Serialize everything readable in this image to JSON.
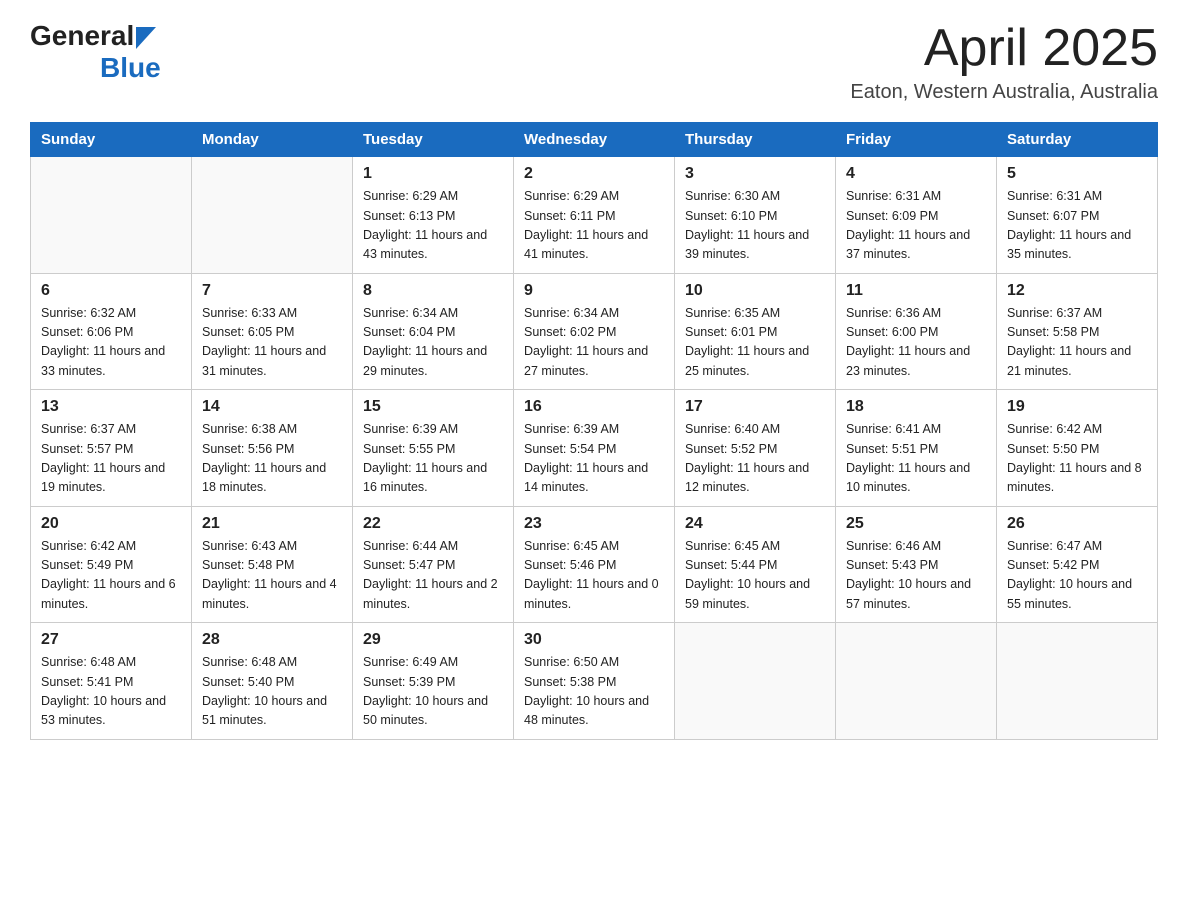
{
  "header": {
    "logo_general": "General",
    "logo_blue": "Blue",
    "title": "April 2025",
    "subtitle": "Eaton, Western Australia, Australia"
  },
  "days_of_week": [
    "Sunday",
    "Monday",
    "Tuesday",
    "Wednesday",
    "Thursday",
    "Friday",
    "Saturday"
  ],
  "weeks": [
    [
      {
        "day": "",
        "sunrise": "",
        "sunset": "",
        "daylight": ""
      },
      {
        "day": "",
        "sunrise": "",
        "sunset": "",
        "daylight": ""
      },
      {
        "day": "1",
        "sunrise": "Sunrise: 6:29 AM",
        "sunset": "Sunset: 6:13 PM",
        "daylight": "Daylight: 11 hours and 43 minutes."
      },
      {
        "day": "2",
        "sunrise": "Sunrise: 6:29 AM",
        "sunset": "Sunset: 6:11 PM",
        "daylight": "Daylight: 11 hours and 41 minutes."
      },
      {
        "day": "3",
        "sunrise": "Sunrise: 6:30 AM",
        "sunset": "Sunset: 6:10 PM",
        "daylight": "Daylight: 11 hours and 39 minutes."
      },
      {
        "day": "4",
        "sunrise": "Sunrise: 6:31 AM",
        "sunset": "Sunset: 6:09 PM",
        "daylight": "Daylight: 11 hours and 37 minutes."
      },
      {
        "day": "5",
        "sunrise": "Sunrise: 6:31 AM",
        "sunset": "Sunset: 6:07 PM",
        "daylight": "Daylight: 11 hours and 35 minutes."
      }
    ],
    [
      {
        "day": "6",
        "sunrise": "Sunrise: 6:32 AM",
        "sunset": "Sunset: 6:06 PM",
        "daylight": "Daylight: 11 hours and 33 minutes."
      },
      {
        "day": "7",
        "sunrise": "Sunrise: 6:33 AM",
        "sunset": "Sunset: 6:05 PM",
        "daylight": "Daylight: 11 hours and 31 minutes."
      },
      {
        "day": "8",
        "sunrise": "Sunrise: 6:34 AM",
        "sunset": "Sunset: 6:04 PM",
        "daylight": "Daylight: 11 hours and 29 minutes."
      },
      {
        "day": "9",
        "sunrise": "Sunrise: 6:34 AM",
        "sunset": "Sunset: 6:02 PM",
        "daylight": "Daylight: 11 hours and 27 minutes."
      },
      {
        "day": "10",
        "sunrise": "Sunrise: 6:35 AM",
        "sunset": "Sunset: 6:01 PM",
        "daylight": "Daylight: 11 hours and 25 minutes."
      },
      {
        "day": "11",
        "sunrise": "Sunrise: 6:36 AM",
        "sunset": "Sunset: 6:00 PM",
        "daylight": "Daylight: 11 hours and 23 minutes."
      },
      {
        "day": "12",
        "sunrise": "Sunrise: 6:37 AM",
        "sunset": "Sunset: 5:58 PM",
        "daylight": "Daylight: 11 hours and 21 minutes."
      }
    ],
    [
      {
        "day": "13",
        "sunrise": "Sunrise: 6:37 AM",
        "sunset": "Sunset: 5:57 PM",
        "daylight": "Daylight: 11 hours and 19 minutes."
      },
      {
        "day": "14",
        "sunrise": "Sunrise: 6:38 AM",
        "sunset": "Sunset: 5:56 PM",
        "daylight": "Daylight: 11 hours and 18 minutes."
      },
      {
        "day": "15",
        "sunrise": "Sunrise: 6:39 AM",
        "sunset": "Sunset: 5:55 PM",
        "daylight": "Daylight: 11 hours and 16 minutes."
      },
      {
        "day": "16",
        "sunrise": "Sunrise: 6:39 AM",
        "sunset": "Sunset: 5:54 PM",
        "daylight": "Daylight: 11 hours and 14 minutes."
      },
      {
        "day": "17",
        "sunrise": "Sunrise: 6:40 AM",
        "sunset": "Sunset: 5:52 PM",
        "daylight": "Daylight: 11 hours and 12 minutes."
      },
      {
        "day": "18",
        "sunrise": "Sunrise: 6:41 AM",
        "sunset": "Sunset: 5:51 PM",
        "daylight": "Daylight: 11 hours and 10 minutes."
      },
      {
        "day": "19",
        "sunrise": "Sunrise: 6:42 AM",
        "sunset": "Sunset: 5:50 PM",
        "daylight": "Daylight: 11 hours and 8 minutes."
      }
    ],
    [
      {
        "day": "20",
        "sunrise": "Sunrise: 6:42 AM",
        "sunset": "Sunset: 5:49 PM",
        "daylight": "Daylight: 11 hours and 6 minutes."
      },
      {
        "day": "21",
        "sunrise": "Sunrise: 6:43 AM",
        "sunset": "Sunset: 5:48 PM",
        "daylight": "Daylight: 11 hours and 4 minutes."
      },
      {
        "day": "22",
        "sunrise": "Sunrise: 6:44 AM",
        "sunset": "Sunset: 5:47 PM",
        "daylight": "Daylight: 11 hours and 2 minutes."
      },
      {
        "day": "23",
        "sunrise": "Sunrise: 6:45 AM",
        "sunset": "Sunset: 5:46 PM",
        "daylight": "Daylight: 11 hours and 0 minutes."
      },
      {
        "day": "24",
        "sunrise": "Sunrise: 6:45 AM",
        "sunset": "Sunset: 5:44 PM",
        "daylight": "Daylight: 10 hours and 59 minutes."
      },
      {
        "day": "25",
        "sunrise": "Sunrise: 6:46 AM",
        "sunset": "Sunset: 5:43 PM",
        "daylight": "Daylight: 10 hours and 57 minutes."
      },
      {
        "day": "26",
        "sunrise": "Sunrise: 6:47 AM",
        "sunset": "Sunset: 5:42 PM",
        "daylight": "Daylight: 10 hours and 55 minutes."
      }
    ],
    [
      {
        "day": "27",
        "sunrise": "Sunrise: 6:48 AM",
        "sunset": "Sunset: 5:41 PM",
        "daylight": "Daylight: 10 hours and 53 minutes."
      },
      {
        "day": "28",
        "sunrise": "Sunrise: 6:48 AM",
        "sunset": "Sunset: 5:40 PM",
        "daylight": "Daylight: 10 hours and 51 minutes."
      },
      {
        "day": "29",
        "sunrise": "Sunrise: 6:49 AM",
        "sunset": "Sunset: 5:39 PM",
        "daylight": "Daylight: 10 hours and 50 minutes."
      },
      {
        "day": "30",
        "sunrise": "Sunrise: 6:50 AM",
        "sunset": "Sunset: 5:38 PM",
        "daylight": "Daylight: 10 hours and 48 minutes."
      },
      {
        "day": "",
        "sunrise": "",
        "sunset": "",
        "daylight": ""
      },
      {
        "day": "",
        "sunrise": "",
        "sunset": "",
        "daylight": ""
      },
      {
        "day": "",
        "sunrise": "",
        "sunset": "",
        "daylight": ""
      }
    ]
  ]
}
